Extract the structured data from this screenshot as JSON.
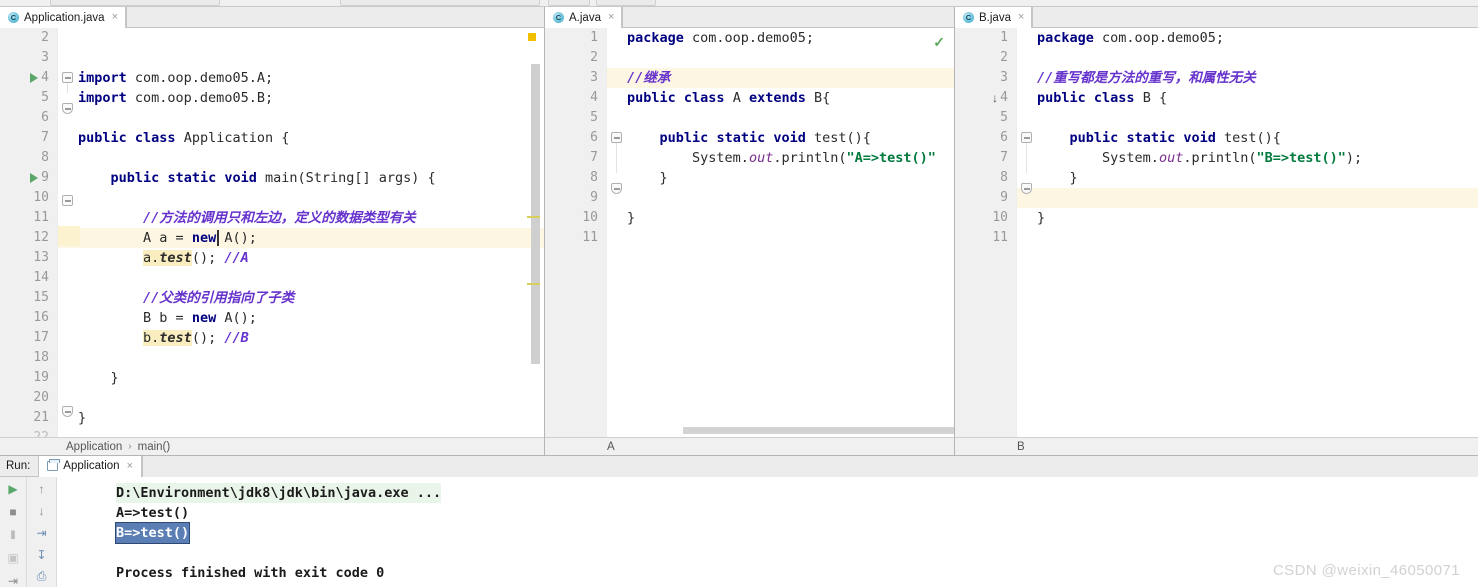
{
  "window": {
    "watermark": "CSDN @weixin_46050071"
  },
  "editors": [
    {
      "tab": {
        "label": "Application.java",
        "icon": "java-class-icon",
        "close": "×"
      },
      "breadcrumb": [
        "Application",
        "main()"
      ],
      "first_line": 2,
      "lines": [
        {
          "n": 2,
          "text": ""
        },
        {
          "n": 3,
          "text": ""
        },
        {
          "n": 4,
          "text": "import com.oop.demo05.A;"
        },
        {
          "n": 5,
          "text": "import com.oop.demo05.B;"
        },
        {
          "n": 6,
          "text": ""
        },
        {
          "n": 7,
          "text": "public class Application {"
        },
        {
          "n": 8,
          "text": ""
        },
        {
          "n": 9,
          "text": "    public static void main(String[] args) {"
        },
        {
          "n": 10,
          "text": ""
        },
        {
          "n": 11,
          "text": "        //方法的调用只和左边，定义的数据类型有关"
        },
        {
          "n": 12,
          "text": "        A a = new A();"
        },
        {
          "n": 13,
          "text": "        a.test(); //A"
        },
        {
          "n": 14,
          "text": ""
        },
        {
          "n": 15,
          "text": "        //父类的引用指向了子类"
        },
        {
          "n": 16,
          "text": "        B b = new A();"
        },
        {
          "n": 17,
          "text": "        b.test(); //B"
        },
        {
          "n": 18,
          "text": ""
        },
        {
          "n": 19,
          "text": "    }"
        },
        {
          "n": 20,
          "text": ""
        },
        {
          "n": 21,
          "text": "}"
        },
        {
          "n": 22,
          "text": ""
        }
      ],
      "caret_line": 12
    },
    {
      "tab": {
        "label": "A.java",
        "icon": "java-class-icon",
        "close": "×"
      },
      "breadcrumb": [
        "A"
      ],
      "first_line": 1,
      "lines": [
        {
          "n": 1,
          "text": "package com.oop.demo05;"
        },
        {
          "n": 2,
          "text": ""
        },
        {
          "n": 3,
          "text": "//继承"
        },
        {
          "n": 4,
          "text": "public class A extends B{"
        },
        {
          "n": 5,
          "text": ""
        },
        {
          "n": 6,
          "text": "    public static void test(){"
        },
        {
          "n": 7,
          "text": "        System.out.println(\"A=>test()\");"
        },
        {
          "n": 8,
          "text": "    }"
        },
        {
          "n": 9,
          "text": ""
        },
        {
          "n": 10,
          "text": "}"
        },
        {
          "n": 11,
          "text": ""
        }
      ],
      "caret_line": 3,
      "inspection_status": "ok-checkmark"
    },
    {
      "tab": {
        "label": "B.java",
        "icon": "java-class-icon",
        "close": "×"
      },
      "breadcrumb": [
        "B"
      ],
      "first_line": 1,
      "lines": [
        {
          "n": 1,
          "text": "package com.oop.demo05;"
        },
        {
          "n": 2,
          "text": ""
        },
        {
          "n": 3,
          "text": "//重写都是方法的重写，和属性无关"
        },
        {
          "n": 4,
          "text": "public class B {"
        },
        {
          "n": 5,
          "text": ""
        },
        {
          "n": 6,
          "text": "    public static void test(){"
        },
        {
          "n": 7,
          "text": "        System.out.println(\"B=>test()\");"
        },
        {
          "n": 8,
          "text": "    }"
        },
        {
          "n": 9,
          "text": ""
        },
        {
          "n": 10,
          "text": "}"
        },
        {
          "n": 11,
          "text": ""
        }
      ],
      "caret_line": 9
    }
  ],
  "code_left": {
    "l4_kw": "import",
    "l4_rest": " com.oop.demo05.A;",
    "l5_kw": "import",
    "l5_rest": " com.oop.demo05.B;",
    "l7_kw1": "public",
    "l7_kw2": "class",
    "l7_name": " Application {",
    "l9_kw1": "public",
    "l9_kw2": "static",
    "l9_kw3": "void",
    "l9_rest": " main(String[] args) {",
    "l11_cmt": "//方法的调用只和左边，定义的数据类型有关",
    "l12_a": "A a = ",
    "l12_kw": "new",
    "l12_b": " A();",
    "l13_obj": "a.",
    "l13_m": "test",
    "l13_rest": "(); ",
    "l13_cmt": "//A",
    "l15_cmt": "//父类的引用指向了子类",
    "l16_a": "B b = ",
    "l16_kw": "new",
    "l16_b": " A();",
    "l17_obj": "b.",
    "l17_m": "test",
    "l17_rest": "(); ",
    "l17_cmt": "//B",
    "l19": "}",
    "l21": "}"
  },
  "code_a": {
    "l1_kw": "package",
    "l1_rest": " com.oop.demo05;",
    "l3_cmt": "//继承",
    "l4_kw1": "public",
    "l4_kw2": "class",
    "l4_mid": " A ",
    "l4_kw3": "extends",
    "l4_end": " B{",
    "l6_kw1": "public",
    "l6_kw2": "static",
    "l6_kw3": "void",
    "l6_rest": " test(){",
    "l7_a": "System.",
    "l7_out": "out",
    "l7_b": ".println(",
    "l7_str": "\"A=>test()\"",
    "l8": "}",
    "l10": "}"
  },
  "code_b": {
    "l1_kw": "package",
    "l1_rest": " com.oop.demo05;",
    "l3_cmt": "//重写都是方法的重写，和属性无关",
    "l4_kw1": "public",
    "l4_kw2": "class",
    "l4_rest": " B {",
    "l6_kw1": "public",
    "l6_kw2": "static",
    "l6_kw3": "void",
    "l6_rest": " test(){",
    "l7_a": "System.",
    "l7_out": "out",
    "l7_b": ".println(",
    "l7_str": "\"B=>test()\"",
    "l7_c": ");",
    "l8": "}",
    "l10": "}"
  },
  "run_panel": {
    "label": "Run:",
    "tab_label": "Application",
    "tab_close": "×",
    "console": [
      {
        "text": "D:\\Environment\\jdk8\\jdk\\bin\\java.exe ...",
        "style": "command"
      },
      {
        "text": "A=>test()",
        "style": "output"
      },
      {
        "text": "B=>test()",
        "style": "selected"
      },
      {
        "text": "",
        "style": "output"
      },
      {
        "text": "Process finished with exit code 0",
        "style": "output"
      }
    ],
    "left_tools": [
      {
        "name": "rerun-icon",
        "glyph": "▶"
      },
      {
        "name": "stop-icon",
        "glyph": "■"
      },
      {
        "name": "pause-icon",
        "glyph": "‖"
      },
      {
        "name": "dump-threads-icon",
        "glyph": "▣"
      },
      {
        "name": "exit-icon",
        "glyph": "⮕"
      }
    ],
    "right_tools": [
      {
        "name": "up-arrow-icon",
        "glyph": "↑"
      },
      {
        "name": "down-arrow-icon",
        "glyph": "↓"
      },
      {
        "name": "soft-wrap-icon",
        "glyph": "↵"
      },
      {
        "name": "scroll-to-end-icon",
        "glyph": "⇥"
      },
      {
        "name": "print-icon",
        "glyph": "⎙"
      }
    ]
  },
  "colors": {
    "keyword": "#000080",
    "comment": "#6633cc",
    "string": "#007a3d",
    "caret_row": "#fdf6e3",
    "selection": "#5b7fb4",
    "run_green": "#59a869"
  }
}
